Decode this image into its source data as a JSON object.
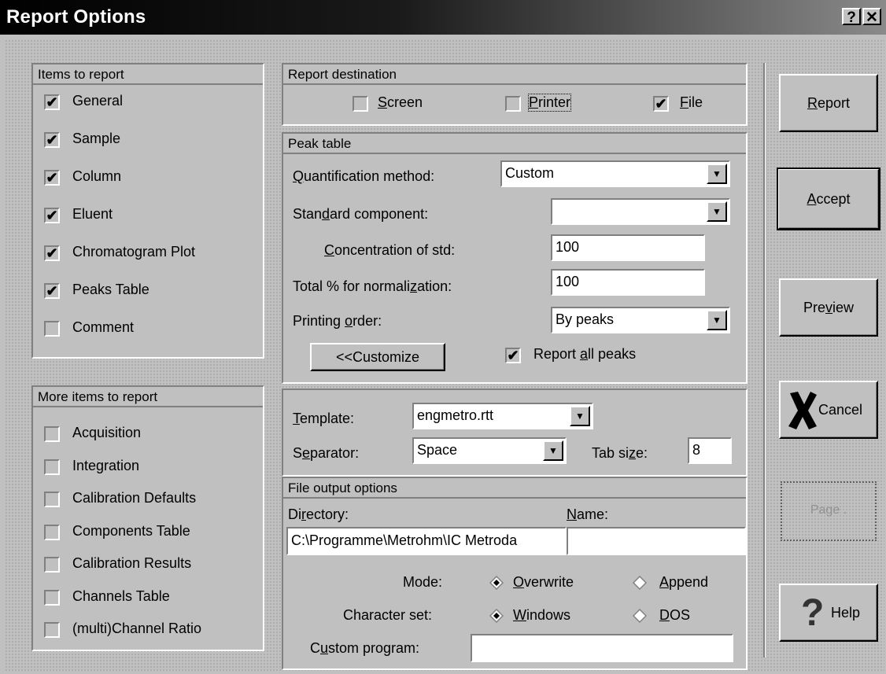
{
  "window": {
    "title": "Report Options",
    "help_btn": "?",
    "close_btn": "✕"
  },
  "items_to_report": {
    "header": "Items to report",
    "items": [
      {
        "label": "General",
        "checked": true
      },
      {
        "label": "Sample",
        "checked": true
      },
      {
        "label": "Column",
        "checked": true
      },
      {
        "label": "Eluent",
        "checked": true
      },
      {
        "label": "Chromatogram Plot",
        "checked": true
      },
      {
        "label": "Peaks Table",
        "checked": true
      },
      {
        "label": "Comment",
        "checked": false
      }
    ]
  },
  "more_items": {
    "header": "More items to report",
    "items": [
      {
        "label": "Acquisition",
        "checked": false
      },
      {
        "label": "Integration",
        "checked": false
      },
      {
        "label": "Calibration Defaults",
        "checked": false
      },
      {
        "label": "Components Table",
        "checked": false
      },
      {
        "label": "Calibration Results",
        "checked": false
      },
      {
        "label": "Channels Table",
        "checked": false
      },
      {
        "label": "(multi)Channel Ratio",
        "checked": false
      }
    ]
  },
  "destination": {
    "header": "Report destination",
    "screen": {
      "label": "Screen",
      "checked": false
    },
    "printer": {
      "label": "Printer",
      "checked": false
    },
    "file": {
      "label": "File",
      "checked": true
    }
  },
  "peak_table": {
    "header": "Peak table",
    "quant_label": "Quantification method:",
    "quant_value": "Custom",
    "std_comp_label": "Standard component:",
    "std_comp_value": "",
    "conc_label": "Concentration of std:",
    "conc_value": "100",
    "total_label": "Total % for normalization:",
    "total_value": "100",
    "order_label": "Printing order:",
    "order_value": "By peaks",
    "customize_btn": "<<Customize",
    "report_all_label": "Report all peaks",
    "report_all_checked": true
  },
  "template": {
    "template_label": "Template:",
    "template_value": "engmetro.rtt",
    "separator_label": "Separator:",
    "separator_value": "Space",
    "tabsize_label": "Tab size:",
    "tabsize_value": "8"
  },
  "file_output": {
    "header": "File output options",
    "directory_label": "Directory:",
    "directory_value": "C:\\Programme\\Metrohm\\IC Metroda",
    "name_label": "Name:",
    "name_value": "",
    "mode_label": "Mode:",
    "overwrite_label": "Overwrite",
    "append_label": "Append",
    "charset_label": "Character set:",
    "windows_label": "Windows",
    "dos_label": "DOS",
    "custom_label": "Custom program:",
    "custom_value": ""
  },
  "buttons": {
    "report": "Report",
    "accept": "Accept",
    "preview": "Preview",
    "cancel": "Cancel",
    "page": "Page .",
    "help": "Help"
  },
  "colors": {
    "title_bar": "#000000",
    "face": "#c0c0c0",
    "disabled_text": "#808080",
    "cancel_x": "#000000"
  }
}
